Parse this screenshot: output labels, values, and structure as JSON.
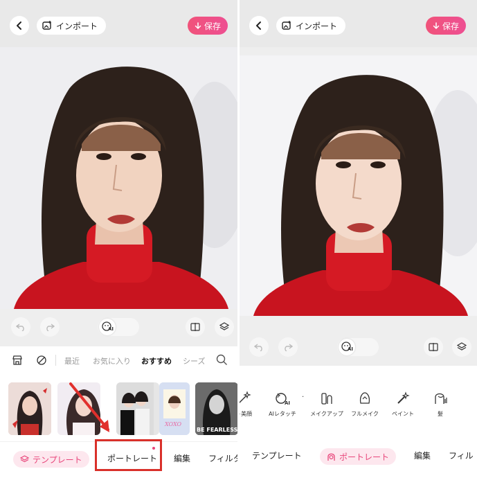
{
  "left": {
    "header": {
      "import_label": "インポート",
      "save_label": "保存"
    },
    "categories": [
      "最近",
      "お気に入り",
      "おすすめ",
      "シーズ"
    ],
    "active_category": "おすすめ",
    "thumbs": [
      {
        "caption": ""
      },
      {
        "caption": ""
      },
      {
        "caption": ""
      },
      {
        "caption": "XOXO"
      },
      {
        "caption": "BE FEARLESS"
      }
    ],
    "tabs": {
      "template": "テンプレート",
      "portrait": "ポートレート",
      "edit": "編集",
      "filter": "フィルタ"
    }
  },
  "right": {
    "header": {
      "import_label": "インポート",
      "save_label": "保存"
    },
    "tools": [
      {
        "label": "ト美顔",
        "icon": "wand-icon"
      },
      {
        "label": "AIレタッチ",
        "icon": "ai-retouch-icon"
      },
      {
        "label": "メイクアップ",
        "icon": "makeup-icon"
      },
      {
        "label": "フルメイク",
        "icon": "full-makeup-icon"
      },
      {
        "label": "ペイント",
        "icon": "paint-icon"
      },
      {
        "label": "髪",
        "icon": "hair-icon"
      }
    ],
    "tabs": {
      "template": "テンプレート",
      "portrait": "ポートレート",
      "edit": "編集",
      "filter": "フィル"
    }
  },
  "ai_badge": "AI",
  "colors": {
    "accent": "#e8457a",
    "save_gradient_start": "#f0537a",
    "save_gradient_end": "#ee4f92",
    "highlight_box": "#d9302a",
    "arrow": "#e1302d"
  }
}
